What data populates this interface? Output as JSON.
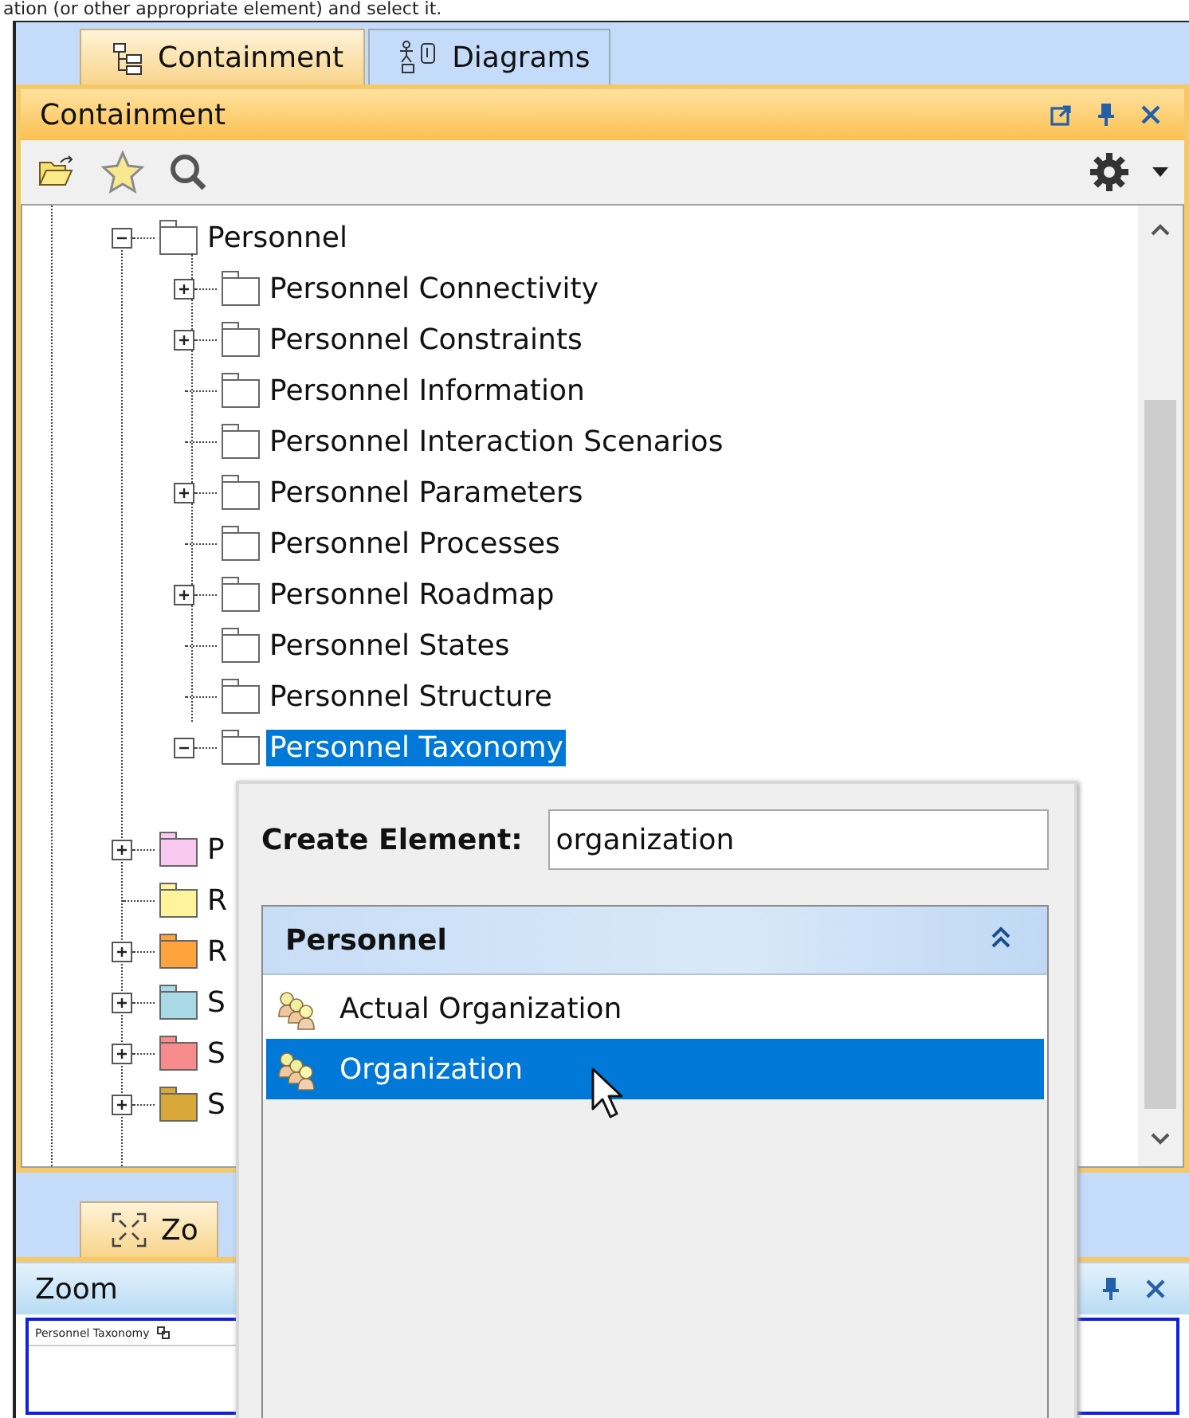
{
  "caption": "ation (or other appropriate element) and select it.",
  "top_tabs": [
    {
      "label": "Containment",
      "kind": "containment",
      "selected": true
    },
    {
      "label": "Diagrams",
      "kind": "diagrams",
      "selected": false
    }
  ],
  "panel": {
    "title": "Containment"
  },
  "tree": {
    "items": [
      {
        "label": "Personnel",
        "kind": "branch",
        "expanded": true,
        "selected": false,
        "children": [
          {
            "label": "Personnel Connectivity",
            "kind": "branch",
            "expanded": false,
            "selected": false
          },
          {
            "label": "Personnel Constraints",
            "kind": "branch",
            "expanded": false,
            "selected": false
          },
          {
            "label": "Personnel Information",
            "kind": "leaf",
            "selected": false
          },
          {
            "label": "Personnel Interaction Scenarios",
            "kind": "leaf",
            "selected": false
          },
          {
            "label": "Personnel Parameters",
            "kind": "branch",
            "expanded": false,
            "selected": false
          },
          {
            "label": "Personnel Processes",
            "kind": "leaf",
            "selected": false
          },
          {
            "label": "Personnel Roadmap",
            "kind": "branch",
            "expanded": false,
            "selected": false
          },
          {
            "label": "Personnel States",
            "kind": "leaf",
            "selected": false
          },
          {
            "label": "Personnel Structure",
            "kind": "leaf",
            "selected": false
          },
          {
            "label": "Personnel Taxonomy",
            "kind": "branch",
            "expanded": true,
            "selected": true
          }
        ]
      },
      {
        "label": "P",
        "kind": "branch",
        "expanded": false,
        "selected": false,
        "color": "#f8c8f0"
      },
      {
        "label": "R",
        "kind": "leaf",
        "selected": false,
        "color": "#fff49c"
      },
      {
        "label": "R",
        "kind": "branch",
        "expanded": false,
        "selected": false,
        "color": "#ffa43c"
      },
      {
        "label": "S",
        "kind": "branch",
        "expanded": false,
        "selected": false,
        "color": "#a8dae6"
      },
      {
        "label": "S",
        "kind": "branch",
        "expanded": false,
        "selected": false,
        "color": "#f88c8c"
      },
      {
        "label": "S",
        "kind": "branch",
        "expanded": false,
        "selected": false,
        "color": "#d8a838"
      }
    ]
  },
  "bottom_tabs": [
    {
      "label": "Zo",
      "kind": "zoom",
      "selected": true
    }
  ],
  "zoom_panel": {
    "title": "Zoom",
    "preview_title": "Personnel Taxonomy"
  },
  "popup": {
    "label": "Create Element:",
    "value": "organization",
    "group": {
      "title": "Personnel",
      "expanded": true
    },
    "items": [
      {
        "label": "Actual Organization",
        "selected": false
      },
      {
        "label": "Organization",
        "selected": true
      }
    ]
  }
}
